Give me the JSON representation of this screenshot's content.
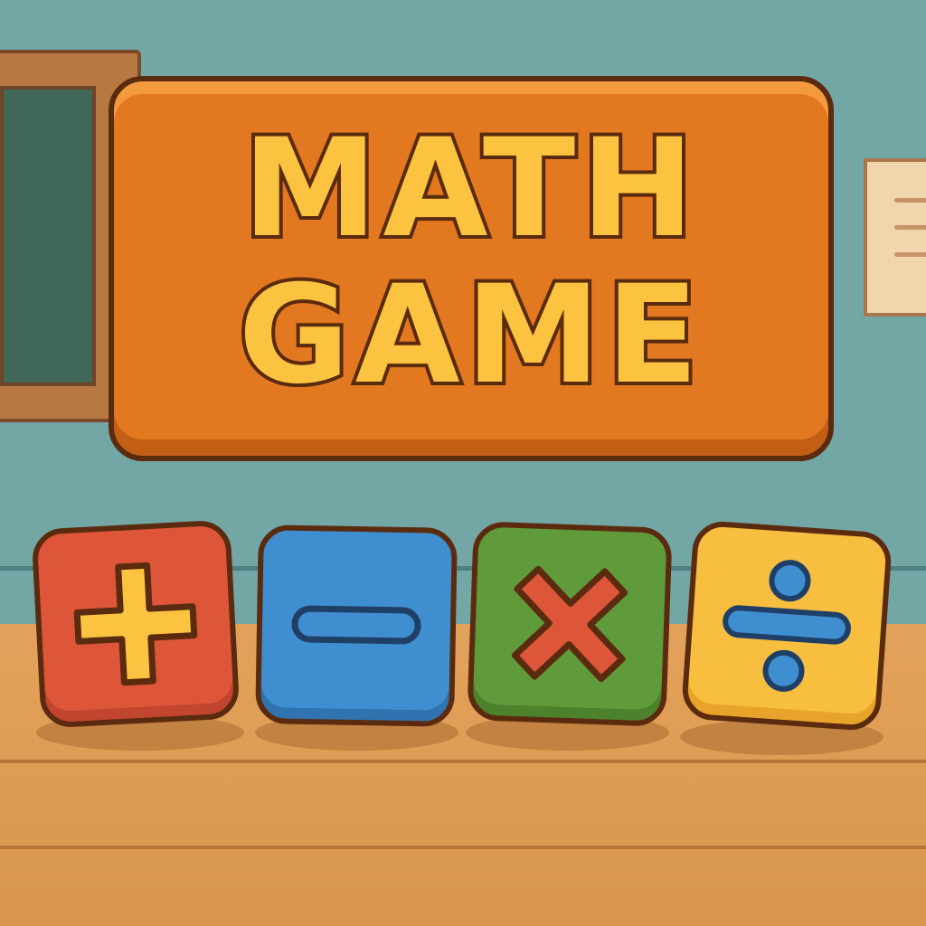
{
  "title": {
    "line1": "MATH",
    "line2": "GAME"
  },
  "operations": [
    {
      "name": "addition",
      "symbol": "+",
      "color": "#de563a",
      "icon_color": "#fbc33f"
    },
    {
      "name": "subtraction",
      "symbol": "−",
      "color": "#3f8ed0",
      "icon_color": "#3f8ed0"
    },
    {
      "name": "multiplication",
      "symbol": "×",
      "color": "#5f9b3a",
      "icon_color": "#de563a"
    },
    {
      "name": "division",
      "symbol": "÷",
      "color": "#f7be3f",
      "icon_color": "#3f8ed0"
    }
  ],
  "colors": {
    "wall": "#72a7a6",
    "floor": "#e3a25b",
    "sign": "#e2781f",
    "title_text": "#fbc33f",
    "outline": "#5b2b0f"
  }
}
